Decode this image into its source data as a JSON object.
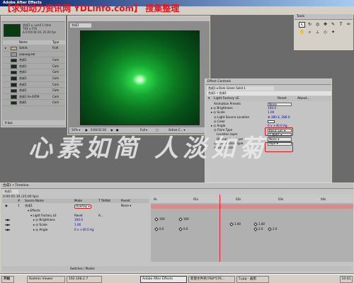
{
  "app": {
    "title": "Adobe After Effects",
    "watermark_top": "【求知动力资讯网 YDLinfo.com】 搜集整理",
    "calligraphy": "心素如简 人淡如菊"
  },
  "project": {
    "comp_name": "合成1 ▾, used 1 time",
    "size": "768 x 576",
    "duration": "Δ 0:00:04:19, 25.00 fps",
    "col_name": "Name",
    "col_type": "Type",
    "items": [
      {
        "twist": "▸",
        "name": "Solids",
        "type": "Fold"
      },
      {
        "twist": "",
        "name": "yepuug.ear",
        "type": ""
      },
      {
        "twist": "",
        "name": "合成1",
        "type": "Com"
      },
      {
        "twist": "",
        "name": "合成1",
        "type": "Com"
      },
      {
        "twist": "",
        "name": "合成1",
        "type": "Com"
      },
      {
        "twist": "",
        "name": "合成1",
        "type": "Com"
      },
      {
        "twist": "",
        "name": "合成1",
        "type": "Com"
      },
      {
        "twist": "",
        "name": "合成1",
        "type": "Com"
      },
      {
        "twist": "",
        "name": "合成1 hx-4459",
        "type": "Com"
      },
      {
        "twist": "",
        "name": "合成1",
        "type": "Com"
      }
    ],
    "footer": "8 bpc"
  },
  "comp": {
    "tab": "合成1",
    "zoom": "50% ▾",
    "timecode": "0:00:01:16",
    "resolution": "Full ▾",
    "camera": "Active C... ▾"
  },
  "tools": {
    "title": "Tools",
    "icons": [
      "arrow-icon",
      "hand-icon",
      "zoom-icon",
      "rotate-icon",
      "orbit-icon",
      "pan-icon",
      "pen-icon",
      "text-icon",
      "brush-icon",
      "stamp-icon",
      "eraser-icon",
      "pin-icon"
    ]
  },
  "fx": {
    "title": "Effect Controls",
    "tab": "合成1 ▾ Dark Green Solid 1",
    "sub": "合成1 • 合成1",
    "effect_name": "Light Factory LE",
    "reset": "Reset",
    "about": "About...",
    "rows": [
      {
        "label": "Animation Presets",
        "value": "None",
        "kind": "select"
      },
      {
        "label": "▸ ◎ Brightness",
        "value": "100.0",
        "kind": "value"
      },
      {
        "label": "▸ ◎ Scale",
        "value": "1.00",
        "kind": "value"
      },
      {
        "label": "◎ Light Source Location",
        "value": "⊕ 380.4, 288.0",
        "kind": "value"
      },
      {
        "label": "◎ Color",
        "value": "",
        "kind": "value"
      },
      {
        "label": "▸ ◎ Angle",
        "value": "0 x +30.0 Ag",
        "kind": "value"
      },
      {
        "label": "◎ Flare Type",
        "value": "Basic Len ▾",
        "kind": "select"
      },
      {
        "label": "Location layer",
        "value": "1.合成1 ▾",
        "kind": "select"
      },
      {
        "label": "Obscuration layer",
        "value": "None ▾",
        "kind": "select"
      },
      {
        "label": "◎ Obscuration Type",
        "value": "Alph ▾",
        "kind": "select"
      },
      {
        "label": "◎ Source size",
        "value": "",
        "kind": "value"
      }
    ]
  },
  "timeline": {
    "title": "合成1 • Timeline",
    "tab": "合成1",
    "timecode": "0:00:01:16 (25.00 fps)",
    "headers": {
      "num": "#",
      "source": "Source Name",
      "mode": "Mode",
      "trkmat": "T TrkMat",
      "parent": "Parent"
    },
    "rows": [
      {
        "num": "1",
        "name": "合成1",
        "mode": "Overlay ▾",
        "trk": "",
        "parent": "None ▾"
      },
      {
        "num": "",
        "name": "▾ Effects",
        "mode": "",
        "trk": "",
        "parent": ""
      },
      {
        "num": "",
        "name": "▾ Light Factory LE",
        "mode": "Reset",
        "trk": "A...",
        "parent": ""
      },
      {
        "num": "",
        "name": "▸ ◎ Brightness",
        "mode": "100.0",
        "trk": "",
        "parent": ""
      },
      {
        "num": "",
        "name": "▸ ◎ Scale",
        "mode": "1.00",
        "trk": "",
        "parent": ""
      },
      {
        "num": "",
        "name": "▸ ◎ Angle",
        "mode": "0 x +30.0 Ag",
        "trk": "",
        "parent": ""
      }
    ],
    "ruler": [
      "0s",
      "01s",
      "02s",
      "03s",
      "04s"
    ],
    "kf_labels": [
      "100",
      "100",
      "1.00",
      "1.00",
      "0.0",
      "0.0",
      "2.0",
      "2.0"
    ],
    "footer_switch": "Switches / Modes"
  },
  "taskbar": {
    "items": [
      {
        "label": "开始",
        "active": false
      },
      {
        "label": "Radmin Viewer",
        "active": false
      },
      {
        "label": "192.168.2.7",
        "active": false
      },
      {
        "label": "Adobe After Effects",
        "active": true
      },
      {
        "label": "新建文件夹(768*576...",
        "active": false
      },
      {
        "label": "5.jpg - 画图",
        "active": false
      }
    ],
    "clock": "10:41"
  }
}
